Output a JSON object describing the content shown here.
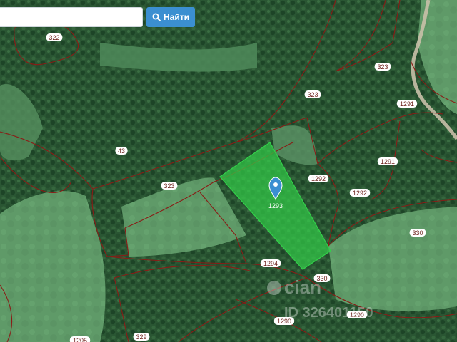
{
  "search": {
    "placeholder": "",
    "value": "",
    "button_label": "Найти",
    "button_icon": "search-icon",
    "button_color": "#3b8fd1"
  },
  "map": {
    "selected_plot": {
      "label": "1293",
      "fill_color": "#33d14a",
      "marker_icon": "map-pin-icon",
      "marker_color": "#3b8fd1"
    },
    "boundary_color": "#8a1c16",
    "plot_labels": [
      "322",
      "323",
      "323",
      "1291",
      "43",
      "1291",
      "323",
      "1292",
      "1292",
      "330",
      "1294",
      "330",
      "1290",
      "1290",
      "329",
      "1205"
    ],
    "watermark": {
      "brand": "cian",
      "text": "ID 326401150"
    }
  }
}
